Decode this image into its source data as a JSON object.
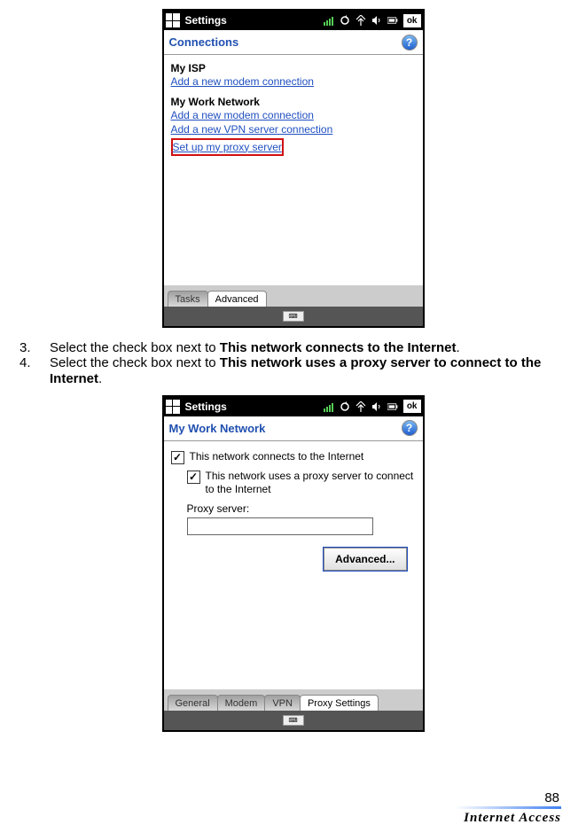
{
  "statusbar": {
    "title": "Settings",
    "ok": "ok"
  },
  "screen1": {
    "title": "Connections",
    "section1": "My ISP",
    "link1a": "Add a new modem connection",
    "section2": "My Work Network",
    "link2a": "Add a new modem connection",
    "link2b": "Add a new VPN server connection",
    "link2c": "Set up my proxy server",
    "tabs": {
      "tasks": "Tasks",
      "advanced": "Advanced"
    }
  },
  "instructions": {
    "step3": {
      "num": "3.",
      "prefix": "Select the check box next to ",
      "bold": "This network connects to the Internet",
      "suffix": "."
    },
    "step4": {
      "num": "4.",
      "prefix": "Select the check box next to ",
      "bold": "This network uses a proxy server to connect to the Internet",
      "suffix": "."
    }
  },
  "screen2": {
    "title": "My Work Network",
    "checkbox1": "This network connects to the Internet",
    "checkbox2": "This network uses a proxy server to connect to the Internet",
    "proxy_label": "Proxy server:",
    "proxy_value": "",
    "advanced_button": "Advanced...",
    "tabs": {
      "general": "General",
      "modem": "Modem",
      "vpn": "VPN",
      "proxy": "Proxy Settings"
    }
  },
  "footer": {
    "page": "88",
    "title": "Internet Access"
  }
}
